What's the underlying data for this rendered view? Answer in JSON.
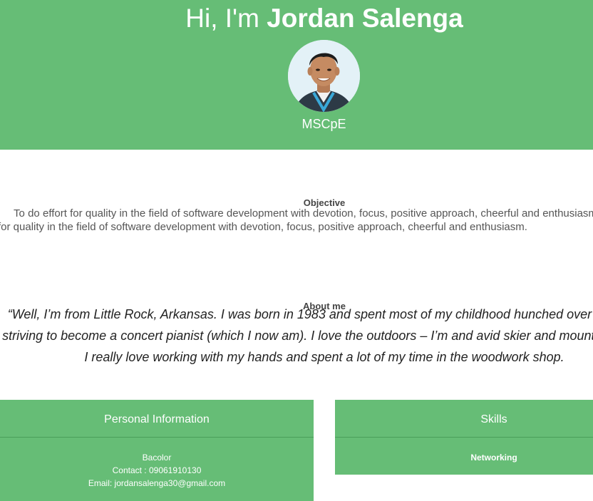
{
  "hero": {
    "greeting": "Hi, I'm",
    "name": "Jordan Salenga",
    "degree": "MSCpE"
  },
  "objective": {
    "heading": "Objective",
    "text": "To do effort for quality in the field of software development with devotion, focus, positive approach, cheerful and enthusiasm.To do effort for quality in the field of software development with devotion, focus, positive approach, cheerful and enthusiasm."
  },
  "about": {
    "heading": "About me",
    "text": "“Well, I’m from Little Rock, Arkansas.  I was born in 1983 and spent most of my childhood hunched over a piano, striving to become a concert pianist (which I now am).  I love the outdoors – I’m and avid skier and mountain biker.  I really love working with my hands and spent a lot of my time in the woodwork shop."
  },
  "personal_info": {
    "title": "Personal Information",
    "address": "Bacolor",
    "contact": "Contact : 09061910130",
    "email": "Email: jordansalenga30@gmail.com"
  },
  "skills": {
    "title": "Skills",
    "items": [
      "Networking"
    ]
  },
  "colors": {
    "accent": "#66bd76",
    "divider": "#4a9e5a"
  },
  "icons": {
    "avatar": "profile-photo"
  }
}
